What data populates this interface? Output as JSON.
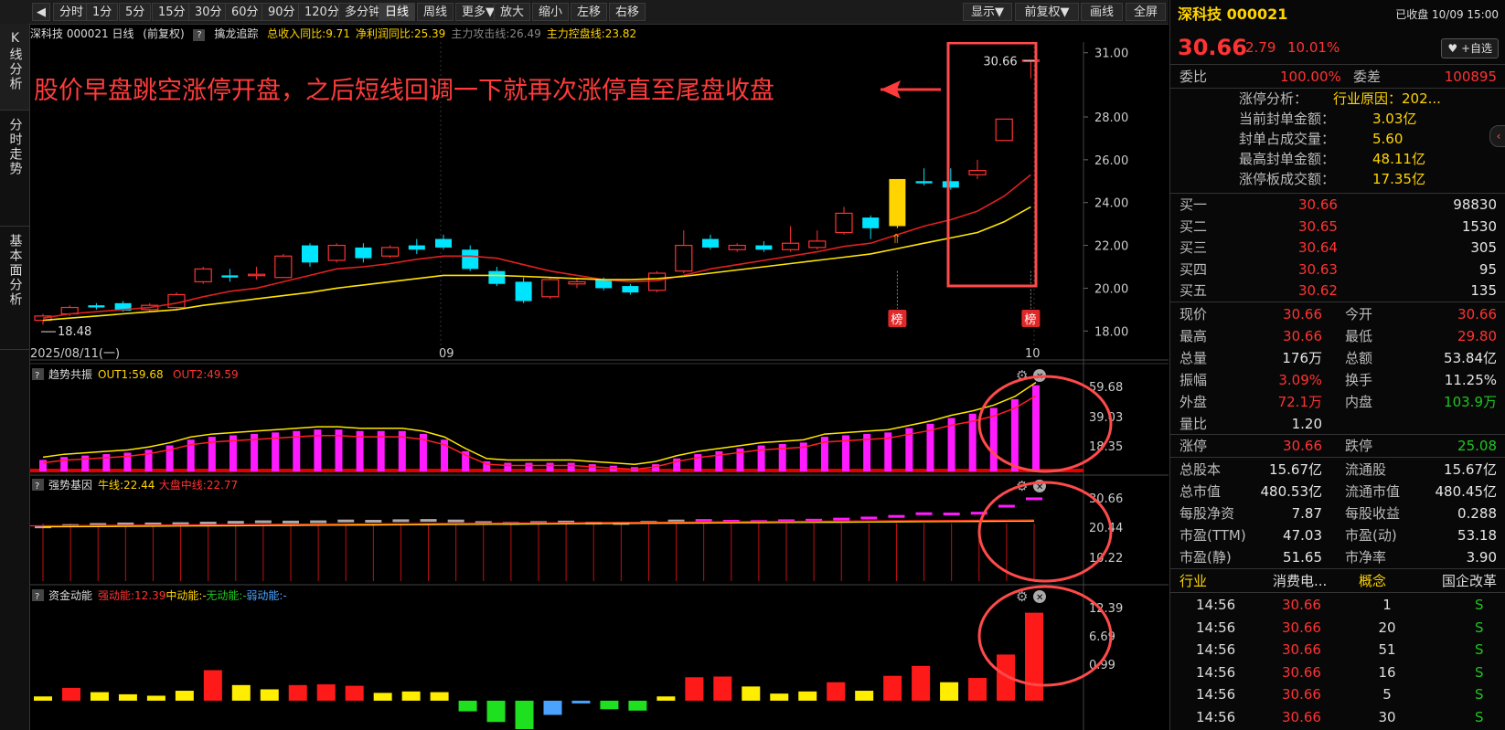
{
  "toolbar": {
    "back_label": "◀",
    "periods": [
      "分时",
      "1分",
      "5分",
      "15分",
      "30分",
      "60分",
      "90分",
      "120分",
      "多分钟",
      "日线",
      "周线",
      "更多▼",
      "放大",
      "缩小",
      "左移",
      "右移"
    ],
    "active_period": "日线",
    "right_buttons": [
      "显示▼",
      "前复权▼",
      "画线",
      "全屏"
    ]
  },
  "side_tabs": [
    {
      "label": "K线分析"
    },
    {
      "label": "分时走势"
    },
    {
      "label": "基本面分析"
    }
  ],
  "main_chart": {
    "title": "深科技 000021 日线",
    "adjust": "(前复权)",
    "indicator_name": "擒龙追踪",
    "indicators": [
      {
        "text": "总收入同比:9.71",
        "color": "#ffd400"
      },
      {
        "text": "净利润同比:25.39",
        "color": "#ffd400"
      },
      {
        "text": "主力攻击线:26.49",
        "color": "#888888"
      },
      {
        "text": "主力控盘线:23.82",
        "color": "#ffd400"
      }
    ],
    "annotation": "股价早盘跳空涨停开盘，之后短线回调一下就再次涨停直至尾盘收盘",
    "high_label": "30.66",
    "low_label": "18.48",
    "badge": "榜",
    "price_axis": [
      "31.00",
      "28.00",
      "26.00",
      "24.00",
      "22.00",
      "20.00",
      "18.00"
    ],
    "date_labels": [
      "2025/08/11(一)",
      "09",
      "10"
    ]
  },
  "chart_data": [
    {
      "type": "candlestick",
      "ylim": [
        17.5,
        31.5
      ],
      "candles": [
        {
          "o": 18.5,
          "h": 18.8,
          "l": 18.3,
          "c": 18.7
        },
        {
          "o": 18.8,
          "h": 19.2,
          "l": 18.7,
          "c": 19.1
        },
        {
          "o": 19.2,
          "h": 19.3,
          "l": 19.0,
          "c": 19.1
        },
        {
          "o": 19.3,
          "h": 19.4,
          "l": 18.9,
          "c": 18.95
        },
        {
          "o": 19.0,
          "h": 19.3,
          "l": 18.9,
          "c": 19.2
        },
        {
          "o": 19.1,
          "h": 19.8,
          "l": 19.0,
          "c": 19.7
        },
        {
          "o": 20.3,
          "h": 21.0,
          "l": 20.2,
          "c": 20.9
        },
        {
          "o": 20.6,
          "h": 20.9,
          "l": 20.3,
          "c": 20.5
        },
        {
          "o": 20.6,
          "h": 21.0,
          "l": 20.4,
          "c": 20.65
        },
        {
          "o": 20.5,
          "h": 21.6,
          "l": 20.5,
          "c": 21.5
        },
        {
          "o": 22.0,
          "h": 22.1,
          "l": 21.0,
          "c": 21.2
        },
        {
          "o": 21.3,
          "h": 22.1,
          "l": 21.2,
          "c": 22.0
        },
        {
          "o": 21.9,
          "h": 22.1,
          "l": 21.2,
          "c": 21.4
        },
        {
          "o": 21.5,
          "h": 22.0,
          "l": 21.4,
          "c": 21.9
        },
        {
          "o": 22.0,
          "h": 22.3,
          "l": 21.6,
          "c": 21.8
        },
        {
          "o": 22.3,
          "h": 22.5,
          "l": 21.8,
          "c": 21.9
        },
        {
          "o": 21.8,
          "h": 22.0,
          "l": 20.8,
          "c": 20.9
        },
        {
          "o": 20.8,
          "h": 21.0,
          "l": 20.1,
          "c": 20.2
        },
        {
          "o": 20.3,
          "h": 20.5,
          "l": 19.3,
          "c": 19.4
        },
        {
          "o": 19.6,
          "h": 20.5,
          "l": 19.5,
          "c": 20.4
        },
        {
          "o": 20.2,
          "h": 20.5,
          "l": 20.0,
          "c": 20.3
        },
        {
          "o": 20.4,
          "h": 20.5,
          "l": 19.9,
          "c": 20.0
        },
        {
          "o": 20.1,
          "h": 20.2,
          "l": 19.7,
          "c": 19.8
        },
        {
          "o": 19.9,
          "h": 20.8,
          "l": 19.8,
          "c": 20.7
        },
        {
          "o": 20.8,
          "h": 22.7,
          "l": 20.7,
          "c": 22.0
        },
        {
          "o": 22.3,
          "h": 22.5,
          "l": 21.8,
          "c": 21.9
        },
        {
          "o": 21.8,
          "h": 22.1,
          "l": 21.7,
          "c": 22.0
        },
        {
          "o": 22.0,
          "h": 22.2,
          "l": 21.7,
          "c": 21.8
        },
        {
          "o": 21.8,
          "h": 22.9,
          "l": 21.7,
          "c": 22.1
        },
        {
          "o": 21.9,
          "h": 22.7,
          "l": 21.8,
          "c": 22.2
        },
        {
          "o": 22.6,
          "h": 23.8,
          "l": 22.5,
          "c": 23.5
        },
        {
          "o": 23.3,
          "h": 23.4,
          "l": 22.3,
          "c": 22.8
        },
        {
          "o": 22.9,
          "h": 25.1,
          "l": 22.8,
          "c": 25.1,
          "limit": true
        },
        {
          "o": 25.0,
          "h": 25.6,
          "l": 24.8,
          "c": 24.9
        },
        {
          "o": 25.0,
          "h": 25.6,
          "l": 24.6,
          "c": 24.7
        },
        {
          "o": 25.3,
          "h": 26.0,
          "l": 25.1,
          "c": 25.5
        },
        {
          "o": 26.9,
          "h": 27.9,
          "l": 26.9,
          "c": 27.9
        },
        {
          "o": 30.66,
          "h": 30.66,
          "l": 29.8,
          "c": 30.66
        }
      ],
      "ma_red": [
        18.6,
        18.8,
        18.9,
        19.0,
        19.1,
        19.3,
        19.6,
        19.85,
        20.0,
        20.3,
        20.6,
        20.9,
        21.0,
        21.15,
        21.35,
        21.5,
        21.5,
        21.4,
        21.1,
        20.8,
        20.6,
        20.4,
        20.3,
        20.35,
        20.6,
        20.9,
        21.1,
        21.3,
        21.5,
        21.7,
        21.95,
        22.1,
        22.5,
        22.9,
        23.2,
        23.6,
        24.3,
        25.3
      ],
      "ma_yellow": [
        18.5,
        18.6,
        18.7,
        18.8,
        18.9,
        19.0,
        19.2,
        19.35,
        19.5,
        19.65,
        19.8,
        20.0,
        20.15,
        20.3,
        20.45,
        20.6,
        20.6,
        20.6,
        20.55,
        20.5,
        20.45,
        20.4,
        20.4,
        20.45,
        20.55,
        20.7,
        20.85,
        21.0,
        21.15,
        21.3,
        21.45,
        21.6,
        21.85,
        22.1,
        22.35,
        22.6,
        23.1,
        23.8
      ]
    },
    {
      "type": "bar",
      "title": "趋势共振",
      "legend": [
        {
          "text": "OUT1:59.68",
          "color": "#ffd400"
        },
        {
          "text": "OUT2:49.59",
          "color": "#ff3333"
        }
      ],
      "axis": [
        "59.68",
        "39.03",
        "18.35"
      ],
      "ylim": [
        0,
        62
      ],
      "values": [
        8,
        10,
        11,
        12,
        13,
        15,
        18,
        22,
        24,
        25,
        26,
        27,
        28,
        29,
        29,
        28,
        28,
        28,
        26,
        22,
        14,
        7,
        6,
        6,
        6,
        6,
        5,
        4,
        3,
        5,
        9,
        12,
        14,
        16,
        18,
        19,
        20,
        24,
        25,
        26,
        27,
        30,
        33,
        37,
        40,
        44,
        50,
        59.68
      ]
    },
    {
      "type": "bar",
      "title": "强势基因",
      "legend": [
        {
          "text": "牛线:22.44",
          "color": "#ffd400"
        },
        {
          "text": "大盘中线:22.77",
          "color": "#ff3333"
        }
      ],
      "axis": [
        "30.66",
        "20.44",
        "10.22"
      ],
      "ylim": [
        0,
        32
      ],
      "values": [
        20.2,
        20.7,
        21.1,
        21.3,
        21.3,
        21.4,
        21.6,
        21.9,
        22.1,
        22.0,
        22.1,
        22.4,
        22.3,
        22.5,
        22.6,
        22.4,
        21.8,
        21.5,
        21.8,
        22.0,
        21.6,
        21.5,
        21.9,
        22.4,
        22.6,
        22.3,
        22.2,
        22.5,
        22.7,
        23.1,
        23.5,
        24.1,
        25.1,
        25.0,
        25.3,
        27.9,
        30.66
      ]
    },
    {
      "type": "bar",
      "title": "资金动能",
      "legend": [
        {
          "text": "强动能:12.39",
          "color": "#ff3333"
        },
        {
          "text": "中动能:-",
          "color": "#ffd400"
        },
        {
          "text": "无动能:-",
          "color": "#1fc61f"
        },
        {
          "text": "弱动能:-",
          "color": "#4aa3ff"
        }
      ],
      "axis": [
        "12.39",
        "6.69",
        "0.99"
      ],
      "ylim": [
        -4,
        13.5
      ],
      "values": [
        0.6,
        1.8,
        1.2,
        0.9,
        0.7,
        1.4,
        4.3,
        2.2,
        1.6,
        2.2,
        2.3,
        2.1,
        1.1,
        1.3,
        1.2,
        -1.5,
        -3.0,
        -4.0,
        -2.0,
        -0.6,
        -1.2,
        -1.4,
        0.6,
        3.3,
        3.4,
        2.0,
        1.0,
        1.3,
        2.6,
        1.4,
        3.5,
        4.9,
        2.6,
        3.2,
        6.5,
        12.39
      ]
    }
  ],
  "quote": {
    "name": "深科技 000021",
    "status": "已收盘 10/09 15:00",
    "price": "30.66",
    "change": "2.79",
    "pct": "10.01%",
    "watch_button": "+自选",
    "weibi_label": "委比",
    "weibi": "100.00%",
    "weicha_label": "委差",
    "weicha": "100895",
    "limit_info": [
      {
        "label": "涨停分析：",
        "value": "行业原因：202..."
      },
      {
        "label": "当前封单金额：",
        "value": "3.03亿"
      },
      {
        "label": "封单占成交量：",
        "value": "5.60"
      },
      {
        "label": "最高封单金额：",
        "value": "48.11亿"
      },
      {
        "label": "涨停板成交额：",
        "value": "17.35亿"
      }
    ],
    "bids": [
      {
        "label": "买一",
        "price": "30.66",
        "vol": "98830"
      },
      {
        "label": "买二",
        "price": "30.65",
        "vol": "1530"
      },
      {
        "label": "买三",
        "price": "30.64",
        "vol": "305"
      },
      {
        "label": "买四",
        "price": "30.63",
        "vol": "95"
      },
      {
        "label": "买五",
        "price": "30.62",
        "vol": "135"
      }
    ],
    "stats": [
      {
        "l1": "现价",
        "v1": "30.66",
        "c1": "red",
        "l2": "今开",
        "v2": "30.66",
        "c2": "red"
      },
      {
        "l1": "最高",
        "v1": "30.66",
        "c1": "red",
        "l2": "最低",
        "v2": "29.80",
        "c2": "red"
      },
      {
        "l1": "总量",
        "v1": "176万",
        "c1": "white",
        "l2": "总额",
        "v2": "53.84亿",
        "c2": "white"
      },
      {
        "l1": "振幅",
        "v1": "3.09%",
        "c1": "red",
        "l2": "换手",
        "v2": "11.25%",
        "c2": "white"
      },
      {
        "l1": "外盘",
        "v1": "72.1万",
        "c1": "red",
        "l2": "内盘",
        "v2": "103.9万",
        "c2": "green"
      },
      {
        "l1": "量比",
        "v1": "1.20",
        "c1": "white",
        "l2": "",
        "v2": "",
        "c2": "white"
      },
      {
        "l1": "涨停",
        "v1": "30.66",
        "c1": "red",
        "l2": "跌停",
        "v2": "25.08",
        "c2": "green"
      },
      {
        "l1": "总股本",
        "v1": "15.67亿",
        "c1": "white",
        "l2": "流通股",
        "v2": "15.67亿",
        "c2": "white"
      },
      {
        "l1": "总市值",
        "v1": "480.53亿",
        "c1": "white",
        "l2": "流通市值",
        "v2": "480.45亿",
        "c2": "white"
      },
      {
        "l1": "每股净资",
        "v1": "7.87",
        "c1": "white",
        "l2": "每股收益",
        "v2": "0.288",
        "c2": "white"
      },
      {
        "l1": "市盈(TTM)",
        "v1": "47.03",
        "c1": "white",
        "l2": "市盈(动)",
        "v2": "53.18",
        "c2": "white"
      },
      {
        "l1": "市盈(静)",
        "v1": "51.65",
        "c1": "white",
        "l2": "市净率",
        "v2": "3.90",
        "c2": "white"
      }
    ],
    "sector": {
      "l1": "行业",
      "v1": "消费电...",
      "l2": "概念",
      "v2": "国企改革"
    },
    "ticks": [
      {
        "time": "14:56",
        "price": "30.66",
        "vol": "1",
        "side": "S"
      },
      {
        "time": "14:56",
        "price": "30.66",
        "vol": "20",
        "side": "S"
      },
      {
        "time": "14:56",
        "price": "30.66",
        "vol": "51",
        "side": "S"
      },
      {
        "time": "14:56",
        "price": "30.66",
        "vol": "16",
        "side": "S"
      },
      {
        "time": "14:56",
        "price": "30.66",
        "vol": "5",
        "side": "S"
      },
      {
        "time": "14:56",
        "price": "30.66",
        "vol": "30",
        "side": "S"
      }
    ],
    "colors": {
      "up": "#ff3333",
      "down": "#1fc61f",
      "limit": "#ffd400",
      "accent": "#ff4a4a"
    }
  }
}
